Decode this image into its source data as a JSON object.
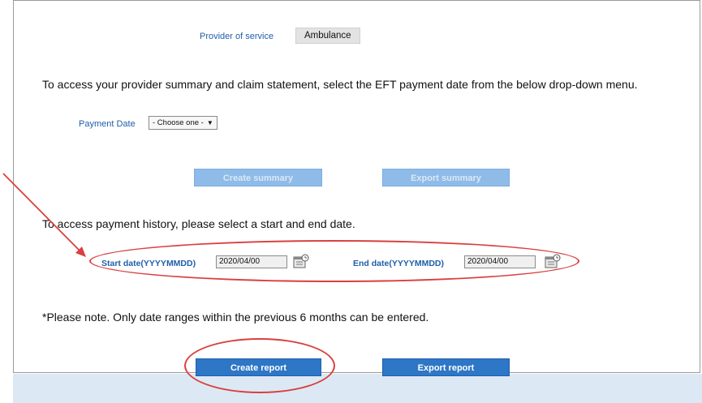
{
  "provider": {
    "label": "Provider of service",
    "value": "Ambulance"
  },
  "instructions": {
    "summary": "To access your provider summary and claim statement, select the EFT payment date from the below drop-down menu.",
    "history": "To access payment history, please select a start and end date.",
    "note": "*Please note. Only date ranges within the previous 6 months can be entered."
  },
  "payment_date": {
    "label": "Payment Date",
    "selected": "- Choose one -",
    "arrow": "▼"
  },
  "buttons": {
    "create_summary": "Create summary",
    "export_summary": "Export summary",
    "create_report": "Create report",
    "export_report": "Export report"
  },
  "dates": {
    "start_label": "Start date(YYYYMMDD)",
    "start_value": "2020/04/00",
    "end_label": "End date(YYYYMMDD)",
    "end_value": "2020/04/00"
  },
  "annotation_color": "#d9403f",
  "icons": {
    "calendar": "calendar-icon",
    "dropdown": "chevron-down-icon"
  }
}
